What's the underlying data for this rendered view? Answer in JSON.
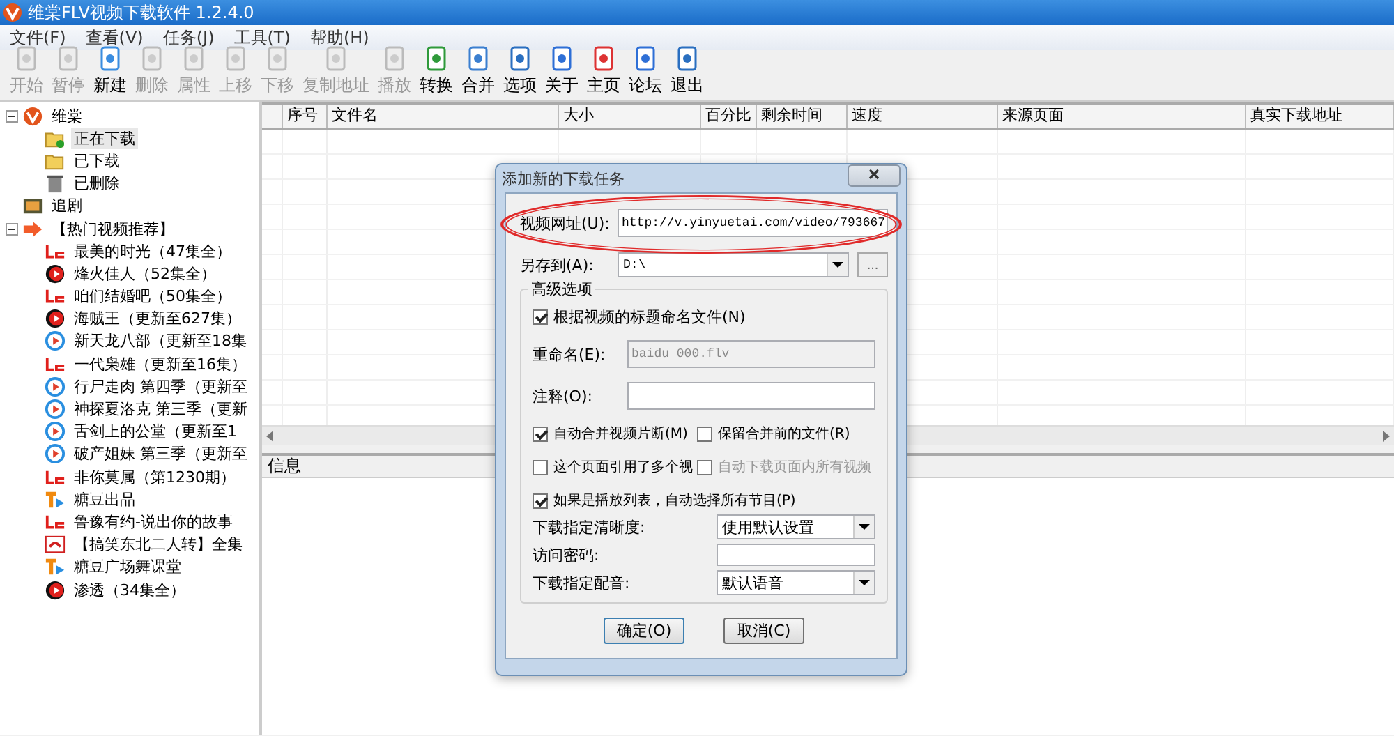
{
  "window": {
    "title": "维棠FLV视频下载软件 1.2.4.0"
  },
  "menu": [
    "文件(F)",
    "查看(V)",
    "任务(J)",
    "工具(T)",
    "帮助(H)"
  ],
  "toolbar": [
    {
      "label": "开始",
      "disabled": true
    },
    {
      "label": "暂停",
      "disabled": true
    },
    {
      "label": "新建",
      "disabled": false
    },
    {
      "label": "删除",
      "disabled": true
    },
    {
      "label": "属性",
      "disabled": true
    },
    {
      "label": "上移",
      "disabled": true
    },
    {
      "label": "下移",
      "disabled": true
    },
    {
      "label": "复制地址",
      "disabled": true
    },
    {
      "label": "播放",
      "disabled": true
    },
    {
      "label": "转换",
      "disabled": false
    },
    {
      "label": "合并",
      "disabled": false
    },
    {
      "label": "选项",
      "disabled": false
    },
    {
      "label": "关于",
      "disabled": false
    },
    {
      "label": "主页",
      "disabled": false
    },
    {
      "label": "论坛",
      "disabled": false
    },
    {
      "label": "退出",
      "disabled": false
    }
  ],
  "tree": [
    {
      "label": "维棠",
      "kind": "logo",
      "expanded": true,
      "selected": false,
      "children": [
        {
          "label": "正在下载",
          "kind": "folder-dl",
          "selected": true
        },
        {
          "label": "已下载",
          "kind": "folder",
          "selected": false
        },
        {
          "label": "已删除",
          "kind": "trash",
          "selected": false
        }
      ]
    },
    {
      "label": "追剧",
      "kind": "tv",
      "selected": false
    },
    {
      "label": "【热门视频推荐】",
      "kind": "arrow",
      "expanded": true,
      "selected": false,
      "children": [
        {
          "label": "最美的时光（47集全）",
          "kind": "le",
          "selected": false
        },
        {
          "label": "烽火佳人（52集全）",
          "kind": "red-play",
          "selected": false
        },
        {
          "label": "咱们结婚吧（50集全）",
          "kind": "le",
          "selected": false
        },
        {
          "label": "海贼王（更新至627集）",
          "kind": "red-play",
          "selected": false
        },
        {
          "label": "新天龙八部（更新至18集",
          "kind": "blue-play",
          "selected": false
        },
        {
          "label": "一代枭雄（更新至16集）",
          "kind": "le",
          "selected": false
        },
        {
          "label": "行尸走肉 第四季（更新至",
          "kind": "blue-play",
          "selected": false
        },
        {
          "label": "神探夏洛克 第三季（更新",
          "kind": "blue-play",
          "selected": false
        },
        {
          "label": "舌剑上的公堂（更新至1",
          "kind": "blue-play",
          "selected": false
        },
        {
          "label": "破产姐妹 第三季（更新至",
          "kind": "blue-play",
          "selected": false
        },
        {
          "label": "非你莫属（第1230期）",
          "kind": "le",
          "selected": false
        },
        {
          "label": "糖豆出品",
          "kind": "td",
          "selected": false
        },
        {
          "label": "鲁豫有约-说出你的故事",
          "kind": "le",
          "selected": false
        },
        {
          "label": "【搞笑东北二人转】全集",
          "kind": "tv-red",
          "selected": false
        },
        {
          "label": "糖豆广场舞课堂",
          "kind": "td",
          "selected": false
        },
        {
          "label": "渗透（34集全）",
          "kind": "red-play",
          "selected": false
        }
      ]
    }
  ],
  "table": {
    "columns": [
      "",
      "序号",
      "文件名",
      "大小",
      "百分比",
      "剩余时间",
      "速度",
      "来源页面",
      "真实下载地址"
    ]
  },
  "info_panel": {
    "title": "信息"
  },
  "dialog": {
    "title": "添加新的下载任务",
    "url": {
      "label": "视频网址(U):",
      "value": "http://v.yinyuetai.com/video/793667"
    },
    "save_to": {
      "label": "另存到(A):",
      "value": "D:\\",
      "browse": "..."
    },
    "group": "高级选项",
    "name_by_title": {
      "label": "根据视频的标题命名文件(N)",
      "checked": true
    },
    "rename": {
      "label": "重命名(E):",
      "value": "baidu_000.flv",
      "disabled": true
    },
    "note": {
      "label": "注释(O):"
    },
    "options": [
      {
        "label": "自动合并视频片断(M)",
        "checked": true,
        "disabled": false
      },
      {
        "label": "保留合并前的文件(R)",
        "checked": false,
        "disabled": false
      },
      {
        "label": "这个页面引用了多个视",
        "checked": false,
        "disabled": false
      },
      {
        "label": "自动下载页面内所有视频",
        "checked": false,
        "disabled": true
      },
      {
        "label": "如果是播放列表，自动选择所有节目(P)",
        "checked": true,
        "disabled": false
      }
    ],
    "quality": {
      "label": "下载指定清晰度:",
      "value": "使用默认设置"
    },
    "password": {
      "label": "访问密码:"
    },
    "dub": {
      "label": "下载指定配音:",
      "value": "默认语音"
    },
    "buttons": [
      "确定(O)",
      "取消(C)"
    ]
  }
}
